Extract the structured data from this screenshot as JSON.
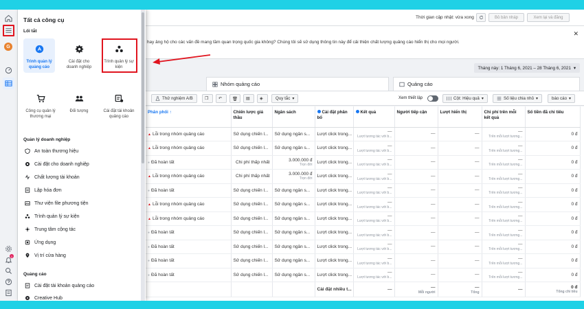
{
  "topbar": {
    "update_text": "Thời gian cập nhật: vừa xong",
    "draft_label": "Bỏ bản nháp",
    "review_label": "Xem lại và đăng"
  },
  "notice": {
    "text": "hay ảng hộ cho các vấn đề mang tầm quan trọng quốc gia không? Chúng tôi sẽ sử dụng thông tin này để cải thiện chất lượng quảng cáo hiển thị cho mọi người."
  },
  "date_range": "Tháng này: 1 Tháng 6, 2021 – 28 Tháng 6, 2021",
  "tabs": {
    "adsets": "Nhóm quảng cáo",
    "ads": "Quảng cáo"
  },
  "toolbar": {
    "ab_test": "Thử nghiệm A/B",
    "rules": "Quy tắc",
    "view_setup": "Xem thiết lập",
    "columns": "Cột: Hiệu quả",
    "breakdown": "Số liệu chia nhỏ",
    "reports": "báo cáo"
  },
  "panel": {
    "title": "Tất cả công cụ",
    "shortcuts_label": "Lối tắt",
    "shortcuts": [
      {
        "label": "Trình quản lý quảng cáo",
        "icon": "ads-manager-icon"
      },
      {
        "label": "Cài đặt cho doanh nghiệp",
        "icon": "gear-icon"
      },
      {
        "label": "Trình quản lý sự kiện",
        "icon": "events-manager-icon"
      },
      {
        "label": "Công cụ quản lý thương mại",
        "icon": "cart-icon"
      },
      {
        "label": "Đối tượng",
        "icon": "audience-icon"
      },
      {
        "label": "Cài đặt tài khoản quảng cáo",
        "icon": "account-settings-icon"
      }
    ],
    "biz_label": "Quản lý doanh nghiệp",
    "biz_items": [
      "An toàn thương hiệu",
      "Cài đặt cho doanh nghiệp",
      "Chất lượng tài khoản",
      "Lập hóa đơn",
      "Thư viện file phương tiện",
      "Trình quản lý sự kiện",
      "Trung tâm cộng tác",
      "Ứng dụng",
      "Vị trí cửa hàng"
    ],
    "ads_label": "Quảng cáo",
    "ads_items": [
      "Cài đặt tài khoản quảng cáo",
      "Creative Hub"
    ]
  },
  "table": {
    "headers": [
      "Phân phối ↑",
      "Chiến lược giá thầu",
      "Ngân sách",
      "Cài đặt phân bổ",
      "Kết quả",
      "Người tiếp cận",
      "Lượt hiển thị",
      "Chi phí trên mỗi kết quả",
      "Số tiền đã chi tiêu"
    ],
    "rows": [
      {
        "status": "Lỗi trong nhóm quảng cáo",
        "s": "warn",
        "bid": "Sử dụng chiến l...",
        "budget": "Sử dụng ngân s...",
        "budget_sub": "",
        "attr": "Lượt click trong..."
      },
      {
        "status": "Lỗi trong nhóm quảng cáo",
        "s": "warn",
        "bid": "Sử dụng chiến l...",
        "budget": "Sử dụng ngân s...",
        "budget_sub": "",
        "attr": "Lượt click trong..."
      },
      {
        "status": "Đã hoàn tất",
        "s": "done",
        "bid": "Chi phí thấp nhất",
        "budget": "3.000.000 đ",
        "budget_sub": "Trọn đời",
        "attr": "Lượt click trong..."
      },
      {
        "status": "Lỗi trong nhóm quảng cáo",
        "s": "warn",
        "bid": "Chi phí thấp nhất",
        "budget": "3.000.000 đ",
        "budget_sub": "Trọn đời",
        "attr": "Lượt click trong..."
      },
      {
        "status": "Đã hoàn tất",
        "s": "done",
        "bid": "Sử dụng chiến l...",
        "budget": "Sử dụng ngân s...",
        "budget_sub": "",
        "attr": "Lượt click trong..."
      },
      {
        "status": "Lỗi trong nhóm quảng cáo",
        "s": "warn",
        "bid": "Sử dụng chiến l...",
        "budget": "Sử dụng ngân s...",
        "budget_sub": "",
        "attr": "Lượt click trong..."
      },
      {
        "status": "Lỗi trong nhóm quảng cáo",
        "s": "warn",
        "bid": "Sử dụng chiến l...",
        "budget": "Sử dụng ngân s...",
        "budget_sub": "",
        "attr": "Lượt click trong..."
      },
      {
        "status": "Đã hoàn tất",
        "s": "done",
        "bid": "Sử dụng chiến l...",
        "budget": "Sử dụng ngân s...",
        "budget_sub": "",
        "attr": "Lượt click trong..."
      },
      {
        "status": "Đã hoàn tất",
        "s": "done",
        "bid": "Sử dụng chiến l...",
        "budget": "Sử dụng ngân s...",
        "budget_sub": "",
        "attr": "Lượt click trong..."
      },
      {
        "status": "Đã hoàn tất",
        "s": "done",
        "bid": "Sử dụng chiến l...",
        "budget": "Sử dụng ngân s...",
        "budget_sub": "",
        "attr": "Lượt click trong..."
      },
      {
        "status": "Đã hoàn tất",
        "s": "done",
        "bid": "Sử dụng chiến l...",
        "budget": "Sử dụng ngân s...",
        "budget_sub": "",
        "attr": "Lượt click trong..."
      }
    ],
    "result_sub": "Lượt tương tác với b...",
    "cpr_sub": "Trên mỗi lượt tương...",
    "row_spend": "0 đ",
    "dash": "—",
    "total": {
      "attr": "Cài đặt nhiều t...",
      "dash": "—",
      "reach_sub": "Mỗi người",
      "impr_sub": "Tổng",
      "spend": "0 đ",
      "spend_sub": "Tổng chi tiêu"
    }
  },
  "rail": {
    "avatar_letter": "G",
    "notif_count": "1"
  },
  "colors": {
    "accent": "#1877f2",
    "highlight": "#e0141e",
    "background": "#1fd1e6"
  }
}
